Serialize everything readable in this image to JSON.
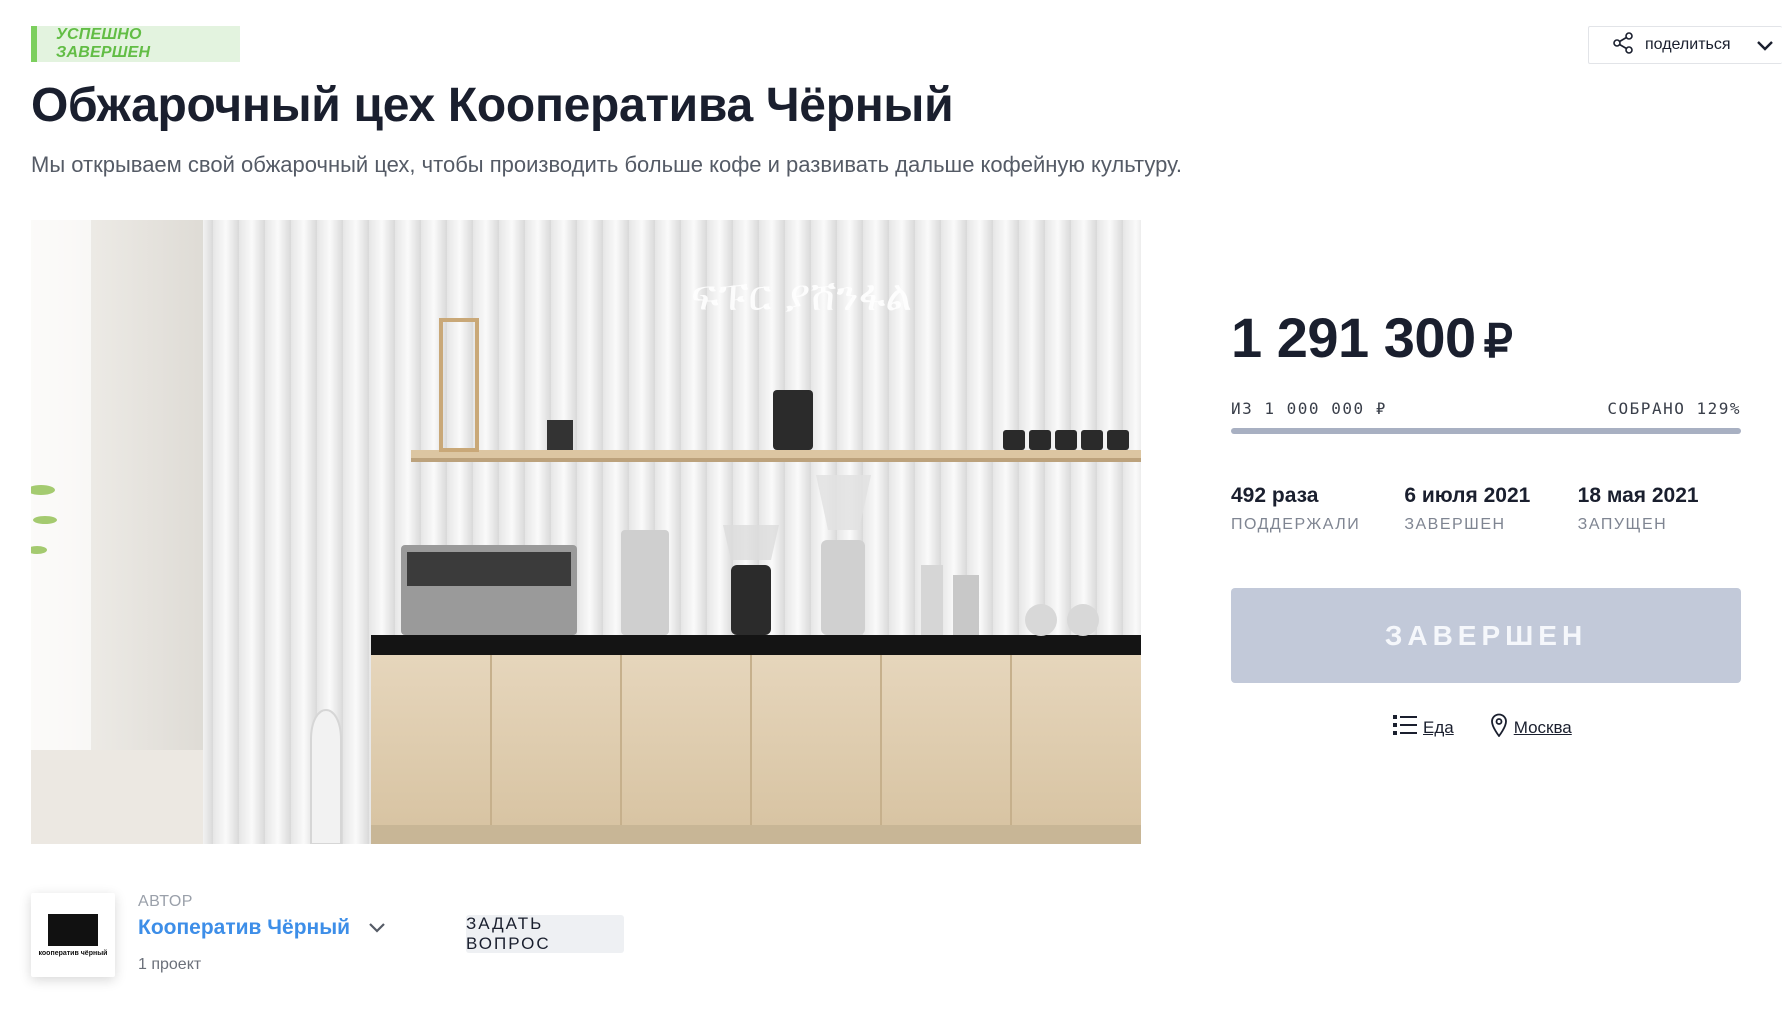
{
  "status_badge": "УСПЕШНО ЗАВЕРШЕН",
  "share": {
    "label": "поделиться"
  },
  "project": {
    "title": "Обжарочный цех Кооператива Чёрный",
    "subtitle": "Мы открываем свой обжарочный цех, чтобы производить больше кофе и развивать дальше кофейную культуру."
  },
  "hero_image": {
    "neon_sign": "ፍፑር ያሸንፋል"
  },
  "funding": {
    "amount": "1 291 300",
    "currency": "₽",
    "goal": "ИЗ 1 000 000 ₽",
    "collected": "СОБРАНО 129%",
    "progress_fraction": 1.0
  },
  "stats": [
    {
      "value": "492 раза",
      "label": "ПОДДЕРЖАЛИ"
    },
    {
      "value": "6 июля 2021",
      "label": "ЗАВЕРШЕН"
    },
    {
      "value": "18 мая 2021",
      "label": "ЗАПУЩЕН"
    }
  ],
  "action_button": "ЗАВЕРШЕН",
  "meta": {
    "category": "Еда",
    "location": "Москва"
  },
  "author": {
    "label": "АВТОР",
    "name": "Кооператив Чёрный",
    "projects": "1 проект",
    "logo_text": "кооператив чёрный"
  },
  "ask_button": "ЗАДАТЬ ВОПРОС",
  "colors": {
    "badge_green": "#62bd45",
    "link_blue": "#3d8ee8",
    "finished_button": "#c2c9d9",
    "title_dark": "#1a1f2e"
  }
}
